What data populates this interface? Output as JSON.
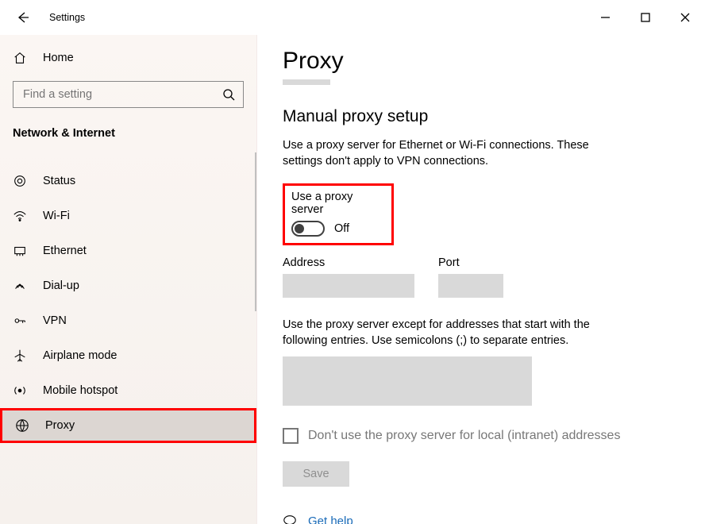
{
  "titlebar": {
    "title": "Settings"
  },
  "sidebar": {
    "home": "Home",
    "search_placeholder": "Find a setting",
    "group": "Network & Internet",
    "items": [
      {
        "key": "status",
        "label": "Status"
      },
      {
        "key": "wifi",
        "label": "Wi-Fi"
      },
      {
        "key": "ethernet",
        "label": "Ethernet"
      },
      {
        "key": "dialup",
        "label": "Dial-up"
      },
      {
        "key": "vpn",
        "label": "VPN"
      },
      {
        "key": "airplane",
        "label": "Airplane mode"
      },
      {
        "key": "hotspot",
        "label": "Mobile hotspot"
      },
      {
        "key": "proxy",
        "label": "Proxy"
      }
    ]
  },
  "main": {
    "page_title": "Proxy",
    "section_title": "Manual proxy setup",
    "description": "Use a proxy server for Ethernet or Wi-Fi connections. These settings don't apply to VPN connections.",
    "toggle_label": "Use a proxy server",
    "toggle_state": "Off",
    "address_label": "Address",
    "port_label": "Port",
    "address_value": "",
    "port_value": "",
    "exceptions_label": "Use the proxy server except for addresses that start with the following entries. Use semicolons (;) to separate entries.",
    "exceptions_value": "",
    "bypass_local_label": "Don't use the proxy server for local (intranet) addresses",
    "save_label": "Save",
    "help_label": "Get help"
  }
}
